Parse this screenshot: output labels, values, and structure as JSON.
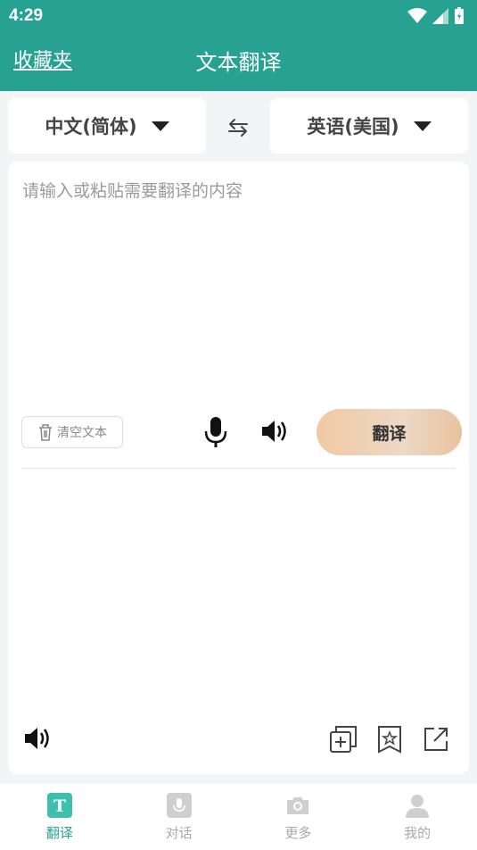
{
  "status": {
    "time": "4:29"
  },
  "appbar": {
    "favorites_label": "收藏夹",
    "title": "文本翻译"
  },
  "lang": {
    "source": "中文(简体)",
    "target": "英语(美国)"
  },
  "input": {
    "placeholder": "请输入或粘贴需要翻译的内容",
    "clear_label": "清空文本",
    "translate_label": "翻译"
  },
  "tabs": [
    {
      "label": "翻译",
      "icon": "text-t-icon",
      "active": true
    },
    {
      "label": "对话",
      "icon": "mic-square-icon",
      "active": false
    },
    {
      "label": "更多",
      "icon": "camera-icon",
      "active": false
    },
    {
      "label": "我的",
      "icon": "person-icon",
      "active": false
    }
  ],
  "colors": {
    "primary": "#26a192",
    "button_gradient": "#f1c9a3"
  }
}
